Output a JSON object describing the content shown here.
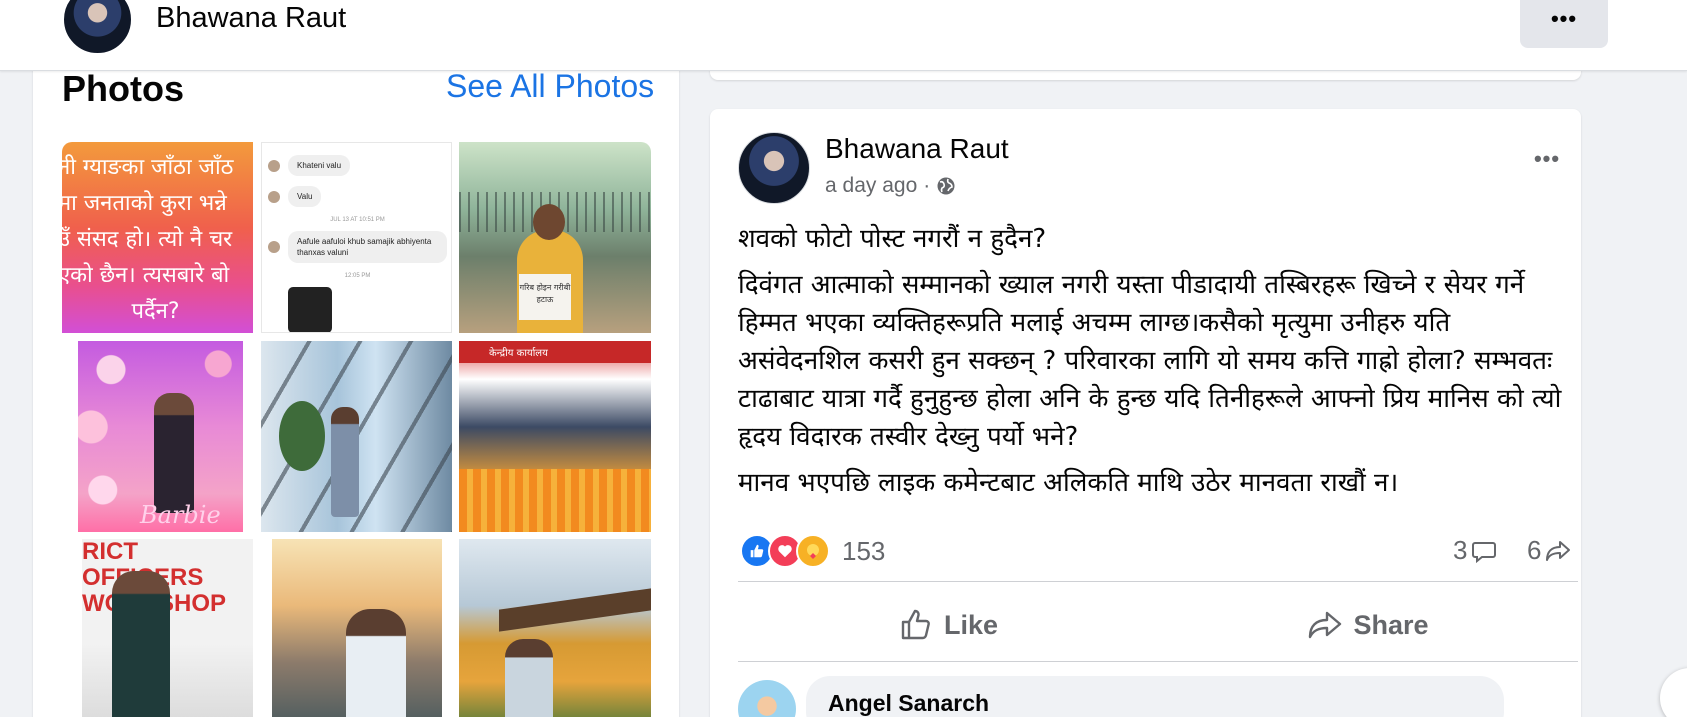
{
  "header": {
    "profile_name": "Bhawana Raut",
    "more_label": "•••"
  },
  "photos": {
    "title": "Photos",
    "see_all": "See All Photos",
    "tile1_lines": [
      "नी ग्याङका जाँठा जाँठ",
      "मा जनताको कुरा भन्ने",
      "उँ संसद हो। त्यो नै चर",
      "एको छैन। त्यसबारे बो",
      "पर्दैन?"
    ],
    "chat": {
      "msg1": "Khateni valu",
      "msg2": "Valu",
      "time1": "JUL 13 AT 10:51 PM",
      "msg3": "Aafule aafuloi khub samajik abhiyenta thanxas valuni",
      "time2": "12:05 PM"
    },
    "protest_sign": "गरिब होइन गरीबी हटाऊ",
    "barbie_text": "Barbie",
    "event_banner": "केन्द्रीय कार्यालय",
    "workshop_text": "RICT OFFICERS WORKSHOP"
  },
  "post": {
    "author": "Bhawana Raut",
    "time": "a day ago",
    "time_sep": "·",
    "more_label": "•••",
    "paragraphs": [
      "शवको फोटो पोस्ट नगरौं न हुदैन?",
      "दिवंगत आत्माको सम्मानको ख्याल नगरी यस्ता पीडादायी तस्बिरहरू खिच्ने र सेयर गर्ने हिम्मत भएका व्यक्तिहरूप्रति मलाई अचम्म लाग्छ।कसैको मृत्युमा उनीहरु यति असंवेदनशिल कसरी हुन सक्छन् ? परिवारका लागि यो समय कत्ति गाह्रो होला? सम्भवतः टाढाबाट यात्रा गर्दै हुनुहुन्छ होला अनि के हुन्छ यदि तिनीहरूले आफ्नो प्रिय मानिस को त्यो हृदय विदारक तस्वीर देख्नु पर्यो भने?",
      "मानव भएपछि लाइक कमेन्टबाट अलिकति माथि उठेर मानवता राखौं न।"
    ],
    "reactions_count": "153",
    "comments_count": "3",
    "shares_count": "6",
    "like_label": "Like",
    "share_label": "Share"
  },
  "comment": {
    "author": "Angel Sanarch"
  },
  "colors": {
    "accent": "#1b74e4",
    "like": "#1877f2",
    "love": "#f33e58",
    "care": "#f7b125",
    "secondary_text": "#65676b"
  }
}
